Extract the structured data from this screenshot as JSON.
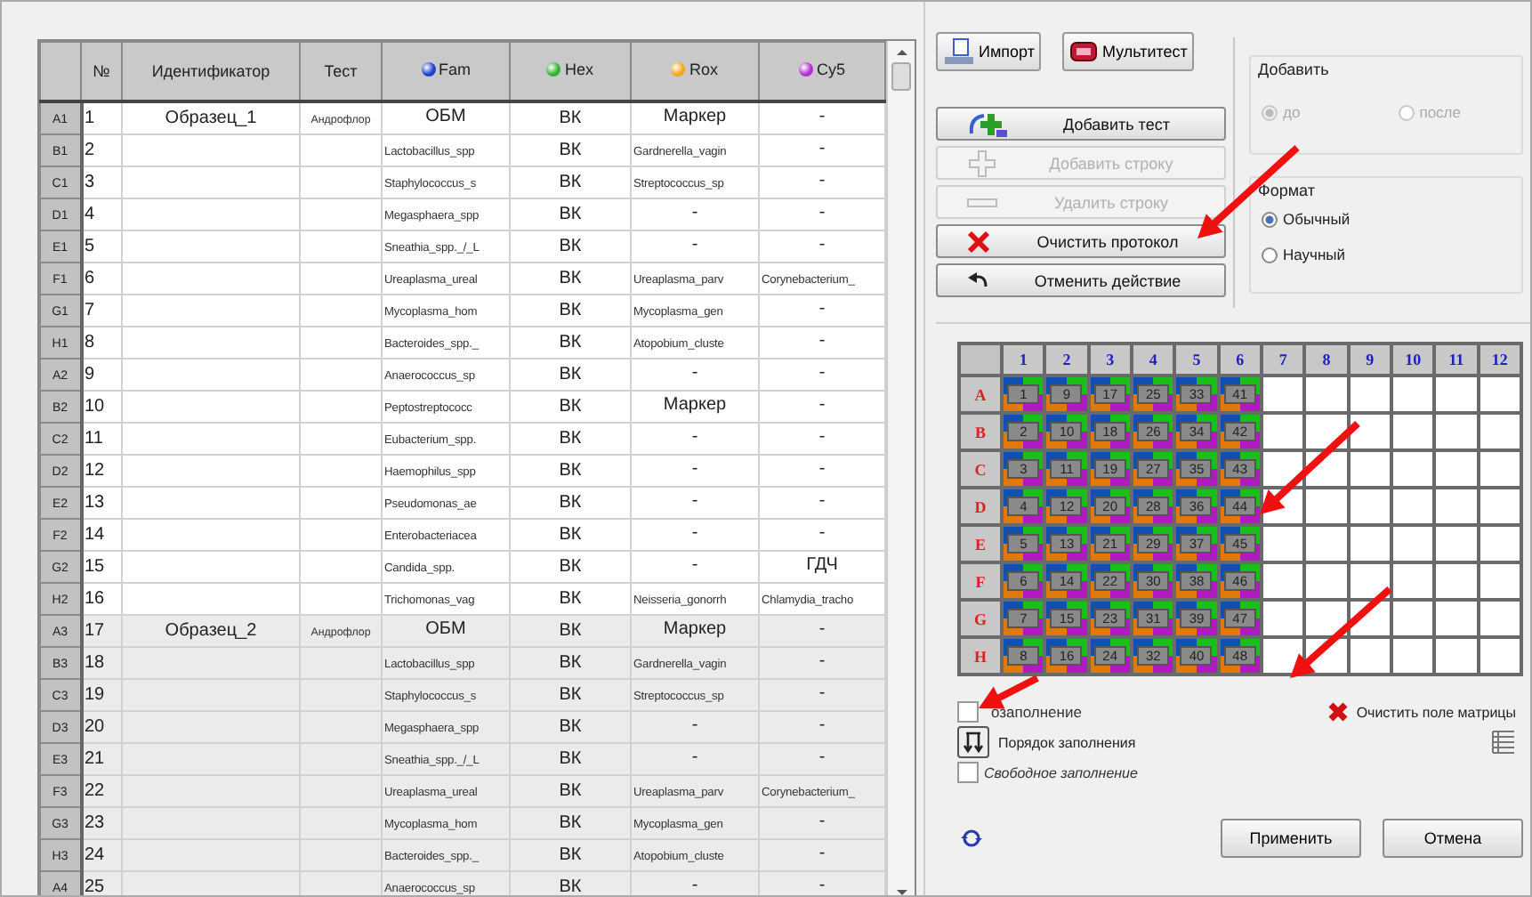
{
  "table": {
    "columns": [
      {
        "label": "№"
      },
      {
        "label": "Идентификатор"
      },
      {
        "label": "Тест"
      },
      {
        "label": "Fam",
        "color": "#1f3fd0"
      },
      {
        "label": "Hex",
        "color": "#2fb52f"
      },
      {
        "label": "Rox",
        "color": "#f2a81c"
      },
      {
        "label": "Cy5",
        "color": "#b52fd0"
      }
    ],
    "rows": [
      {
        "label": "A1",
        "shaded": false,
        "cells": [
          "1",
          "Образец_1",
          "Андрофлор",
          "ОБМ",
          "ВК",
          "Маркер",
          "-"
        ]
      },
      {
        "label": "B1",
        "shaded": false,
        "cells": [
          "2",
          "",
          "",
          "Lactobacillus_spp",
          "ВК",
          "Gardnerella_vagin",
          "-"
        ]
      },
      {
        "label": "C1",
        "shaded": false,
        "cells": [
          "3",
          "",
          "",
          "Staphylococcus_s",
          "ВК",
          "Streptococcus_sp",
          "-"
        ]
      },
      {
        "label": "D1",
        "shaded": false,
        "cells": [
          "4",
          "",
          "",
          "Megasphaera_spp",
          "ВК",
          "-",
          "-"
        ]
      },
      {
        "label": "E1",
        "shaded": false,
        "cells": [
          "5",
          "",
          "",
          "Sneathia_spp._/_L",
          "ВК",
          "-",
          "-"
        ]
      },
      {
        "label": "F1",
        "shaded": false,
        "cells": [
          "6",
          "",
          "",
          "Ureaplasma_ureal",
          "ВК",
          "Ureaplasma_parv",
          "Corynebacterium_"
        ]
      },
      {
        "label": "G1",
        "shaded": false,
        "cells": [
          "7",
          "",
          "",
          "Mycoplasma_hom",
          "ВК",
          "Mycoplasma_gen",
          "-"
        ]
      },
      {
        "label": "H1",
        "shaded": false,
        "cells": [
          "8",
          "",
          "",
          "Bacteroides_spp._",
          "ВК",
          "Atopobium_cluste",
          "-"
        ]
      },
      {
        "label": "A2",
        "shaded": false,
        "cells": [
          "9",
          "",
          "",
          "Anaerococcus_sp",
          "ВК",
          "-",
          "-"
        ]
      },
      {
        "label": "B2",
        "shaded": false,
        "cells": [
          "10",
          "",
          "",
          "Peptostreptococc",
          "ВК",
          "Маркер",
          "-"
        ]
      },
      {
        "label": "C2",
        "shaded": false,
        "cells": [
          "11",
          "",
          "",
          "Eubacterium_spp.",
          "ВК",
          "-",
          "-"
        ]
      },
      {
        "label": "D2",
        "shaded": false,
        "cells": [
          "12",
          "",
          "",
          "Haemophilus_spp",
          "ВК",
          "-",
          "-"
        ]
      },
      {
        "label": "E2",
        "shaded": false,
        "cells": [
          "13",
          "",
          "",
          "Pseudomonas_ae",
          "ВК",
          "-",
          "-"
        ]
      },
      {
        "label": "F2",
        "shaded": false,
        "cells": [
          "14",
          "",
          "",
          "Enterobacteriacea",
          "ВК",
          "-",
          "-"
        ]
      },
      {
        "label": "G2",
        "shaded": false,
        "cells": [
          "15",
          "",
          "",
          "Candida_spp.",
          "ВК",
          "-",
          "ГДЧ"
        ]
      },
      {
        "label": "H2",
        "shaded": false,
        "cells": [
          "16",
          "",
          "",
          "Trichomonas_vag",
          "ВК",
          "Neisseria_gonorrh",
          "Chlamydia_tracho"
        ]
      },
      {
        "label": "A3",
        "shaded": true,
        "cells": [
          "17",
          "Образец_2",
          "Андрофлор",
          "ОБМ",
          "ВК",
          "Маркер",
          "-"
        ]
      },
      {
        "label": "B3",
        "shaded": true,
        "cells": [
          "18",
          "",
          "",
          "Lactobacillus_spp",
          "ВК",
          "Gardnerella_vagin",
          "-"
        ]
      },
      {
        "label": "C3",
        "shaded": true,
        "cells": [
          "19",
          "",
          "",
          "Staphylococcus_s",
          "ВК",
          "Streptococcus_sp",
          "-"
        ]
      },
      {
        "label": "D3",
        "shaded": true,
        "cells": [
          "20",
          "",
          "",
          "Megasphaera_spp",
          "ВК",
          "-",
          "-"
        ]
      },
      {
        "label": "E3",
        "shaded": true,
        "cells": [
          "21",
          "",
          "",
          "Sneathia_spp._/_L",
          "ВК",
          "-",
          "-"
        ]
      },
      {
        "label": "F3",
        "shaded": true,
        "cells": [
          "22",
          "",
          "",
          "Ureaplasma_ureal",
          "ВК",
          "Ureaplasma_parv",
          "Corynebacterium_"
        ]
      },
      {
        "label": "G3",
        "shaded": true,
        "cells": [
          "23",
          "",
          "",
          "Mycoplasma_hom",
          "ВК",
          "Mycoplasma_gen",
          "-"
        ]
      },
      {
        "label": "H3",
        "shaded": true,
        "cells": [
          "24",
          "",
          "",
          "Bacteroides_spp._",
          "ВК",
          "Atopobium_cluste",
          "-"
        ]
      },
      {
        "label": "A4",
        "shaded": true,
        "cells": [
          "25",
          "",
          "",
          "Anaerococcus_sp",
          "ВК",
          "-",
          "-"
        ]
      }
    ]
  },
  "toolbar": [
    {
      "kind": "import",
      "label": "Импорт"
    },
    {
      "kind": "multitest",
      "label": "Мультитест"
    }
  ],
  "actions": [
    {
      "kind": "add_test",
      "label": "Добавить тест",
      "disabled": false
    },
    {
      "kind": "add_row",
      "label": "Добавить строку",
      "disabled": true
    },
    {
      "kind": "delete_row",
      "label": "Удалить строку",
      "disabled": true
    },
    {
      "kind": "clear",
      "label": "Очистить протокол",
      "disabled": false
    },
    {
      "kind": "undo",
      "label": "Отменить действие",
      "disabled": false
    }
  ],
  "add_position": {
    "title": "Добавить",
    "disabled": true,
    "options": [
      {
        "label": "до",
        "selected": true
      },
      {
        "label": "после",
        "selected": false
      }
    ]
  },
  "format": {
    "title": "Формат",
    "disabled": false,
    "options": [
      {
        "label": "Обычный",
        "selected": true
      },
      {
        "label": "Научный",
        "selected": false
      }
    ]
  },
  "plate": {
    "columns": [
      "1",
      "2",
      "3",
      "4",
      "5",
      "6",
      "7",
      "8",
      "9",
      "10",
      "11",
      "12"
    ],
    "rows": [
      {
        "label": "A",
        "wells": [
          {
            "filled": true,
            "label": "1"
          },
          {
            "filled": true,
            "label": "9"
          },
          {
            "filled": true,
            "label": "17"
          },
          {
            "filled": true,
            "label": "25"
          },
          {
            "filled": true,
            "label": "33"
          },
          {
            "filled": true,
            "label": "41"
          },
          {
            "filled": false
          },
          {
            "filled": false
          },
          {
            "filled": false
          },
          {
            "filled": false
          },
          {
            "filled": false
          },
          {
            "filled": false
          }
        ]
      },
      {
        "label": "B",
        "wells": [
          {
            "filled": true,
            "label": "2"
          },
          {
            "filled": true,
            "label": "10"
          },
          {
            "filled": true,
            "label": "18"
          },
          {
            "filled": true,
            "label": "26"
          },
          {
            "filled": true,
            "label": "34"
          },
          {
            "filled": true,
            "label": "42"
          },
          {
            "filled": false
          },
          {
            "filled": false
          },
          {
            "filled": false
          },
          {
            "filled": false
          },
          {
            "filled": false
          },
          {
            "filled": false
          }
        ]
      },
      {
        "label": "C",
        "wells": [
          {
            "filled": true,
            "label": "3"
          },
          {
            "filled": true,
            "label": "11"
          },
          {
            "filled": true,
            "label": "19"
          },
          {
            "filled": true,
            "label": "27"
          },
          {
            "filled": true,
            "label": "35"
          },
          {
            "filled": true,
            "label": "43"
          },
          {
            "filled": false
          },
          {
            "filled": false
          },
          {
            "filled": false
          },
          {
            "filled": false
          },
          {
            "filled": false
          },
          {
            "filled": false
          }
        ]
      },
      {
        "label": "D",
        "wells": [
          {
            "filled": true,
            "label": "4"
          },
          {
            "filled": true,
            "label": "12"
          },
          {
            "filled": true,
            "label": "20"
          },
          {
            "filled": true,
            "label": "28"
          },
          {
            "filled": true,
            "label": "36"
          },
          {
            "filled": true,
            "label": "44"
          },
          {
            "filled": false
          },
          {
            "filled": false
          },
          {
            "filled": false
          },
          {
            "filled": false
          },
          {
            "filled": false
          },
          {
            "filled": false
          }
        ]
      },
      {
        "label": "E",
        "wells": [
          {
            "filled": true,
            "label": "5"
          },
          {
            "filled": true,
            "label": "13"
          },
          {
            "filled": true,
            "label": "21"
          },
          {
            "filled": true,
            "label": "29"
          },
          {
            "filled": true,
            "label": "37"
          },
          {
            "filled": true,
            "label": "45"
          },
          {
            "filled": false
          },
          {
            "filled": false
          },
          {
            "filled": false
          },
          {
            "filled": false
          },
          {
            "filled": false
          },
          {
            "filled": false
          }
        ]
      },
      {
        "label": "F",
        "wells": [
          {
            "filled": true,
            "label": "6"
          },
          {
            "filled": true,
            "label": "14"
          },
          {
            "filled": true,
            "label": "22"
          },
          {
            "filled": true,
            "label": "30"
          },
          {
            "filled": true,
            "label": "38"
          },
          {
            "filled": true,
            "label": "46"
          },
          {
            "filled": false
          },
          {
            "filled": false
          },
          {
            "filled": false
          },
          {
            "filled": false
          },
          {
            "filled": false
          },
          {
            "filled": false
          }
        ]
      },
      {
        "label": "G",
        "wells": [
          {
            "filled": true,
            "label": "7"
          },
          {
            "filled": true,
            "label": "15"
          },
          {
            "filled": true,
            "label": "23"
          },
          {
            "filled": true,
            "label": "31"
          },
          {
            "filled": true,
            "label": "39"
          },
          {
            "filled": true,
            "label": "47"
          },
          {
            "filled": false
          },
          {
            "filled": false
          },
          {
            "filled": false
          },
          {
            "filled": false
          },
          {
            "filled": false
          },
          {
            "filled": false
          }
        ]
      },
      {
        "label": "H",
        "wells": [
          {
            "filled": true,
            "label": "8"
          },
          {
            "filled": true,
            "label": "16"
          },
          {
            "filled": true,
            "label": "24"
          },
          {
            "filled": true,
            "label": "32"
          },
          {
            "filled": true,
            "label": "40"
          },
          {
            "filled": true,
            "label": "48"
          },
          {
            "filled": false
          },
          {
            "filled": false
          },
          {
            "filled": false
          },
          {
            "filled": false
          },
          {
            "filled": false
          },
          {
            "filled": false
          }
        ]
      }
    ]
  },
  "autofill": {
    "label": "озаполнение",
    "checked": false
  },
  "clear_matrix": {
    "label": "Очистить поле матрицы"
  },
  "fill_order": {
    "label": "Порядок заполнения"
  },
  "free_fill": {
    "label": "Свободное заполнение",
    "checked": false
  },
  "dialog_buttons": [
    {
      "label": "Применить"
    },
    {
      "label": "Отмена"
    }
  ],
  "annotations": [
    {
      "kind": "arrow"
    },
    {
      "kind": "arrow"
    },
    {
      "kind": "arrow"
    },
    {
      "kind": "arrow"
    }
  ]
}
